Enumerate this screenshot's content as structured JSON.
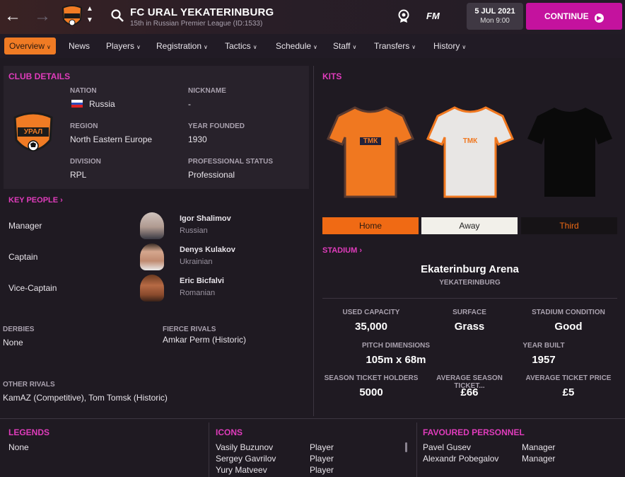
{
  "header": {
    "title": "FC URAL YEKATERINBURG",
    "subtitle": "15th in Russian Premier League (ID:1533)",
    "fm_label": "FM",
    "date": "5 JUL 2021",
    "time": "Mon 9:00",
    "continue_label": "CONTINUE"
  },
  "tabs": [
    {
      "label": "Overview",
      "dropdown": true,
      "active": true
    },
    {
      "label": "News",
      "dropdown": false
    },
    {
      "label": "Players",
      "dropdown": true
    },
    {
      "label": "Registration",
      "dropdown": true
    },
    {
      "label": "Tactics",
      "dropdown": true
    },
    {
      "label": "Schedule",
      "dropdown": true
    },
    {
      "label": "Staff",
      "dropdown": true
    },
    {
      "label": "Transfers",
      "dropdown": true
    },
    {
      "label": "History",
      "dropdown": true
    }
  ],
  "club_details": {
    "heading": "CLUB DETAILS",
    "nation_label": "NATION",
    "nation": "Russia",
    "nickname_label": "NICKNAME",
    "nickname": "-",
    "region_label": "REGION",
    "region": "North Eastern Europe",
    "founded_label": "YEAR FOUNDED",
    "founded": "1930",
    "division_label": "DIVISION",
    "division": "RPL",
    "status_label": "PROFESSIONAL STATUS",
    "status": "Professional",
    "crest_text": "УРАЛ"
  },
  "key_people": {
    "heading": "KEY PEOPLE",
    "people": [
      {
        "role": "Manager",
        "name": "Igor Shalimov",
        "nationality": "Russian"
      },
      {
        "role": "Captain",
        "name": "Denys Kulakov",
        "nationality": "Ukrainian"
      },
      {
        "role": "Vice-Captain",
        "name": "Eric Bicfalvi",
        "nationality": "Romanian"
      }
    ]
  },
  "rivals": {
    "derbies_label": "DERBIES",
    "derbies": "None",
    "fierce_label": "FIERCE RIVALS",
    "fierce": "Amkar Perm (Historic)",
    "other_label": "OTHER RIVALS",
    "other": "KamAZ (Competitive), Tom Tomsk (Historic)"
  },
  "kits": {
    "heading": "KITS",
    "sponsor": "ТМК",
    "buttons": [
      {
        "label": "Home",
        "color": "#f06a14",
        "text_color": "#2a1a10"
      },
      {
        "label": "Away",
        "color": "#f2f0ea",
        "text_color": "#222222"
      },
      {
        "label": "Third",
        "color": "#161316",
        "text_color": "#f06a14"
      }
    ]
  },
  "stadium": {
    "heading": "STADIUM",
    "name": "Ekaterinburg Arena",
    "city": "YEKATERINBURG",
    "used_capacity_label": "USED CAPACITY",
    "used_capacity": "35,000",
    "surface_label": "SURFACE",
    "surface": "Grass",
    "condition_label": "STADIUM CONDITION",
    "condition": "Good",
    "pitch_label": "PITCH DIMENSIONS",
    "pitch": "105m x 68m",
    "built_label": "YEAR BUILT",
    "built": "1957",
    "season_holders_label": "SEASON TICKET HOLDERS",
    "season_holders": "5000",
    "avg_season_label": "AVERAGE SEASON TICKET...",
    "avg_season": "£66",
    "avg_ticket_label": "AVERAGE TICKET PRICE",
    "avg_ticket": "£5"
  },
  "legends": {
    "heading": "LEGENDS",
    "value": "None"
  },
  "icons": {
    "heading": "ICONS",
    "rows": [
      {
        "name": "Vasily Buzunov",
        "role": "Player"
      },
      {
        "name": "Sergey Gavrilov",
        "role": "Player"
      },
      {
        "name": "Yury Matveev",
        "role": "Player"
      }
    ]
  },
  "favoured": {
    "heading": "FAVOURED PERSONNEL",
    "rows": [
      {
        "name": "Pavel Gusev",
        "role": "Manager"
      },
      {
        "name": "Alexandr Pobegalov",
        "role": "Manager"
      }
    ]
  },
  "colors": {
    "accent": "#e03cbc",
    "orange": "#f07b24",
    "continue": "#c4129e"
  },
  "icon_names": [
    "back-arrow-icon",
    "forward-arrow-icon",
    "club-crest-icon",
    "chevron-up-icon",
    "chevron-down-icon",
    "search-icon",
    "award-icon",
    "continue-arrow-icon"
  ]
}
